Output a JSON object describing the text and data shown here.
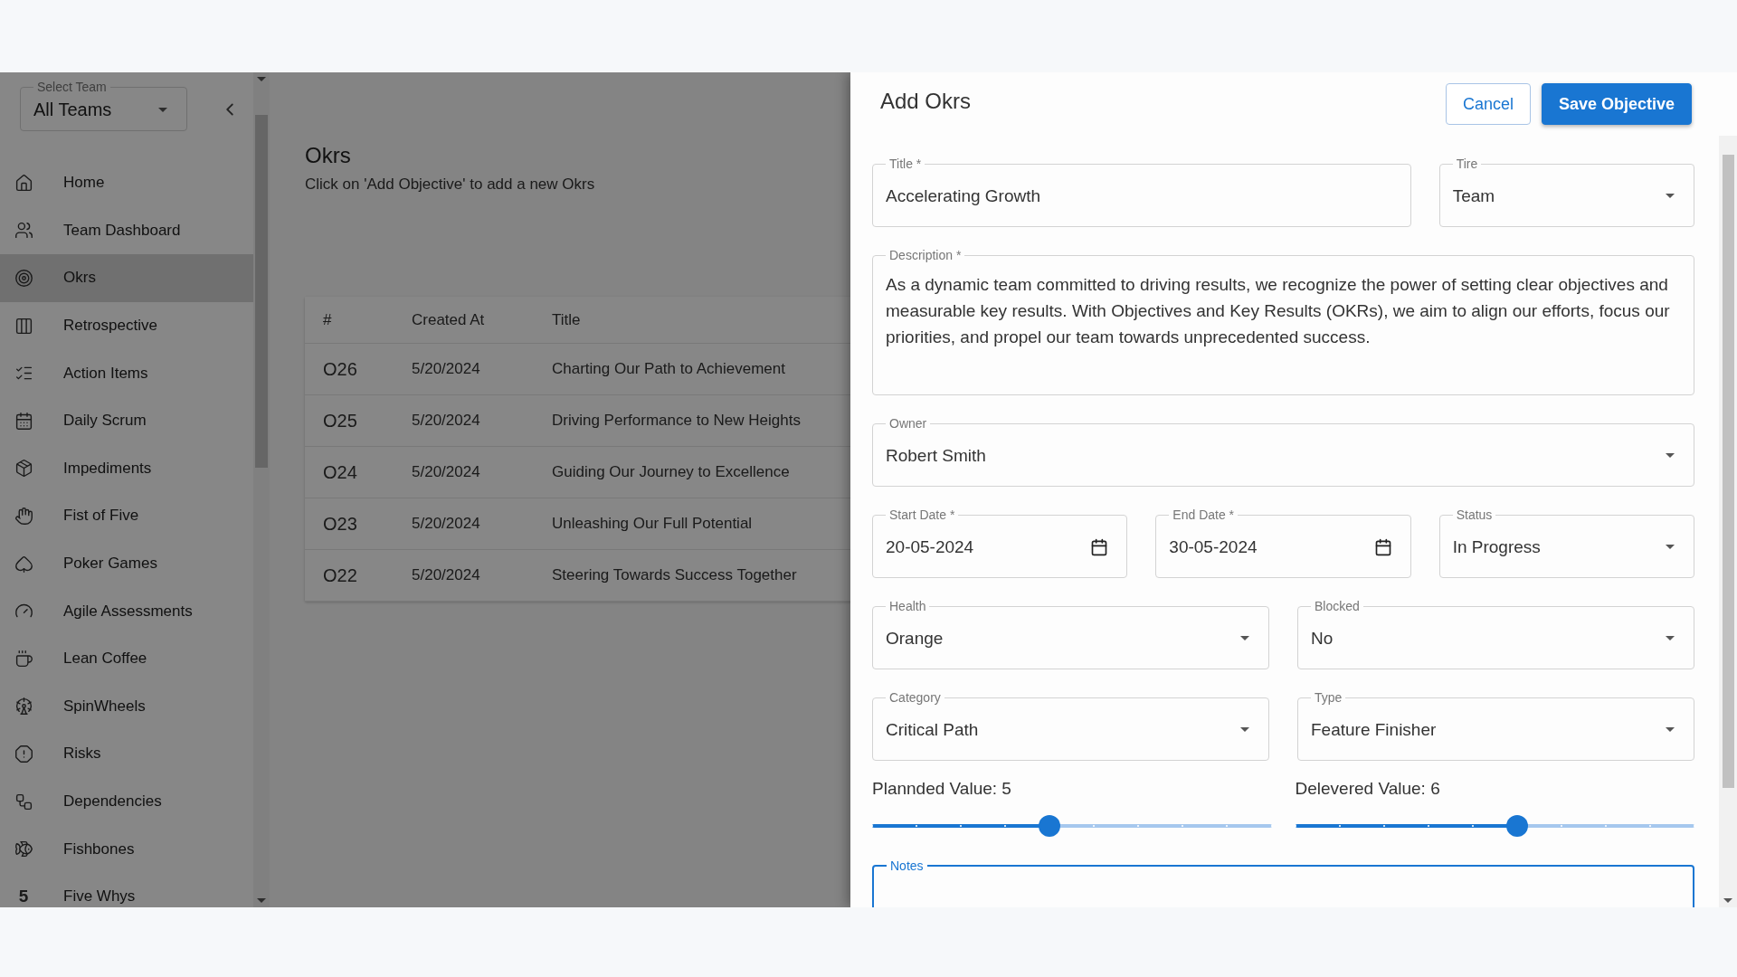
{
  "team_select": {
    "label": "Select Team",
    "value": "All Teams"
  },
  "sidebar": {
    "items": [
      {
        "label": "Home",
        "selected": false
      },
      {
        "label": "Team Dashboard",
        "selected": false
      },
      {
        "label": "Okrs",
        "selected": true
      },
      {
        "label": "Retrospective",
        "selected": false
      },
      {
        "label": "Action Items",
        "selected": false
      },
      {
        "label": "Daily Scrum",
        "selected": false
      },
      {
        "label": "Impediments",
        "selected": false
      },
      {
        "label": "Fist of Five",
        "selected": false
      },
      {
        "label": "Poker Games",
        "selected": false
      },
      {
        "label": "Agile Assessments",
        "selected": false
      },
      {
        "label": "Lean Coffee",
        "selected": false
      },
      {
        "label": "SpinWheels",
        "selected": false
      },
      {
        "label": "Risks",
        "selected": false
      },
      {
        "label": "Dependencies",
        "selected": false
      },
      {
        "label": "Fishbones",
        "selected": false
      },
      {
        "label": "Five Whys",
        "selected": false,
        "glyph": "5"
      }
    ]
  },
  "page": {
    "title": "Okrs",
    "hint": "Click on 'Add Objective' to add a new Okrs"
  },
  "table": {
    "columns": [
      "#",
      "Created At",
      "Title"
    ],
    "rows": [
      [
        "O26",
        "5/20/2024",
        "Charting Our Path to Achievement"
      ],
      [
        "O25",
        "5/20/2024",
        "Driving Performance to New Heights"
      ],
      [
        "O24",
        "5/20/2024",
        "Guiding Our Journey to Excellence"
      ],
      [
        "O23",
        "5/20/2024",
        "Unleashing Our Full Potential"
      ],
      [
        "O22",
        "5/20/2024",
        "Steering Towards Success Together"
      ]
    ]
  },
  "drawer": {
    "title": "Add Okrs",
    "buttons": [
      {
        "label": "Cancel",
        "kind": "outlined"
      },
      {
        "label": "Save Objective",
        "kind": "contained"
      }
    ],
    "fields": [
      {
        "kind": "text",
        "label": "Title *",
        "value": "Accelerating Growth"
      },
      {
        "kind": "select",
        "label": "Tire",
        "value": "Team"
      },
      {
        "kind": "textarea",
        "label": "Description *",
        "value": "As a dynamic team committed to driving results, we recognize the power of setting clear objectives and measurable key results. With Objectives and Key Results (OKRs), we aim to align our efforts, focus our priorities, and propel our team towards unprecedented success."
      },
      {
        "kind": "select",
        "label": "Owner",
        "value": "Robert Smith"
      },
      {
        "kind": "date",
        "label": "Start Date *",
        "value": "20-05-2024"
      },
      {
        "kind": "date",
        "label": "End Date *",
        "value": "30-05-2024"
      },
      {
        "kind": "select",
        "label": "Status",
        "value": "In Progress"
      },
      {
        "kind": "select",
        "label": "Health",
        "value": "Orange"
      },
      {
        "kind": "select",
        "label": "Blocked",
        "value": "No"
      },
      {
        "kind": "select",
        "label": "Category",
        "value": "Critical Path"
      },
      {
        "kind": "select",
        "label": "Type",
        "value": "Feature Finisher"
      }
    ],
    "sliders": [
      {
        "label": "Plannded Value: 5",
        "level": 0.444
      },
      {
        "label": "Delevered Value: 6",
        "level": 0.556
      }
    ],
    "notes": {
      "label": "Notes",
      "focused": true
    }
  }
}
